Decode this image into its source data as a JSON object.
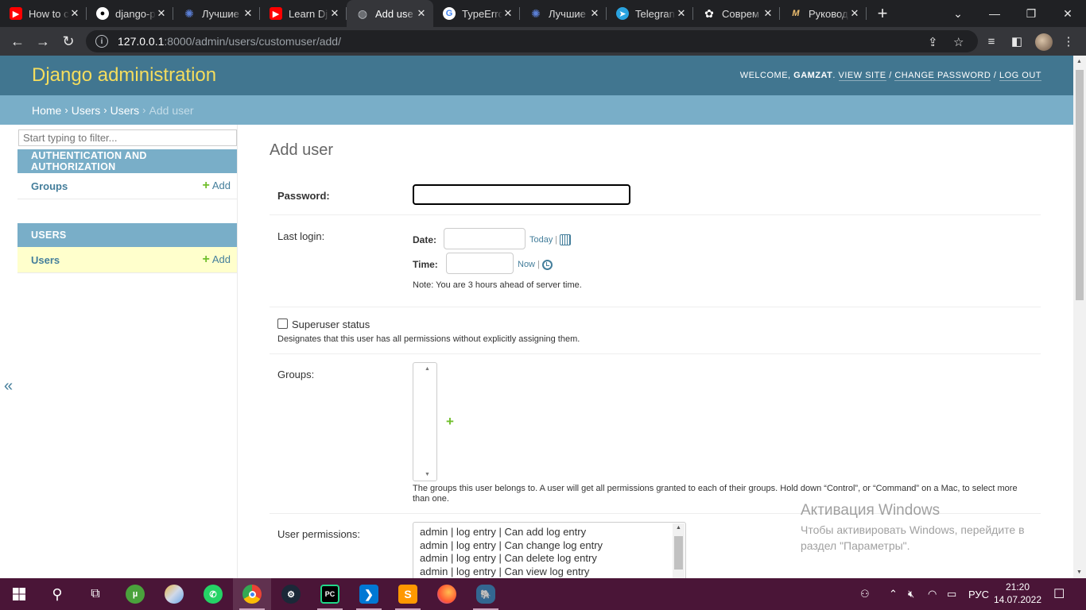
{
  "browser": {
    "tabs": [
      {
        "title": "How to c",
        "icon": "youtube-icon",
        "active": false
      },
      {
        "title": "django-p",
        "icon": "github-icon",
        "active": false
      },
      {
        "title": "Лучшие",
        "icon": "globe-icon",
        "active": false
      },
      {
        "title": "Learn Dj",
        "icon": "youtube-icon",
        "active": false
      },
      {
        "title": "Add use",
        "icon": "globe-icon",
        "active": true
      },
      {
        "title": "TypeErro",
        "icon": "google-icon",
        "active": false
      },
      {
        "title": "Лучшие",
        "icon": "globe-icon",
        "active": false
      },
      {
        "title": "Telegran",
        "icon": "telegram-icon",
        "active": false
      },
      {
        "title": "Соврем",
        "icon": "openai-icon",
        "active": false
      },
      {
        "title": "Руковод",
        "icon": "metanit-icon",
        "active": false
      }
    ],
    "url_host": "127.0.0.1",
    "url_path": ":8000/admin/users/customuser/add/"
  },
  "header": {
    "branding": "Django administration",
    "welcome": "Welcome,",
    "username": "gamzat",
    "view_site": "View site",
    "change_password": "Change password",
    "log_out": "Log out"
  },
  "breadcrumbs": {
    "home": "Home",
    "app": "Users",
    "model": "Users",
    "current": "Add user"
  },
  "sidebar": {
    "filter_placeholder": "Start typing to filter...",
    "apps": [
      {
        "caption": "AUTHENTICATION AND AUTHORIZATION",
        "model": "Groups",
        "add": "Add"
      },
      {
        "caption": "USERS",
        "model": "Users",
        "add": "Add"
      }
    ],
    "toggle": "«"
  },
  "form": {
    "title": "Add user",
    "password_label": "Password:",
    "last_login_label": "Last login:",
    "date_label": "Date:",
    "today": "Today",
    "time_label": "Time:",
    "now": "Now",
    "sep": "|",
    "tz_note": "Note: You are 3 hours ahead of server time.",
    "superuser_label": "Superuser status",
    "superuser_help": "Designates that this user has all permissions without explicitly assigning them.",
    "groups_label": "Groups:",
    "groups_help": "The groups this user belongs to. A user will get all permissions granted to each of their groups. Hold down “Control”, or “Command” on a Mac, to select more than one.",
    "permissions_label": "User permissions:",
    "permissions": [
      "admin | log entry | Can add log entry",
      "admin | log entry | Can change log entry",
      "admin | log entry | Can delete log entry",
      "admin | log entry | Can view log entry"
    ]
  },
  "watermark": {
    "line1": "Активация Windows",
    "line2": "Чтобы активировать Windows, перейдите в раздел \"Параметры\"."
  },
  "taskbar": {
    "lang": "РУС",
    "time": "21:20",
    "date": "14.07.2022"
  }
}
